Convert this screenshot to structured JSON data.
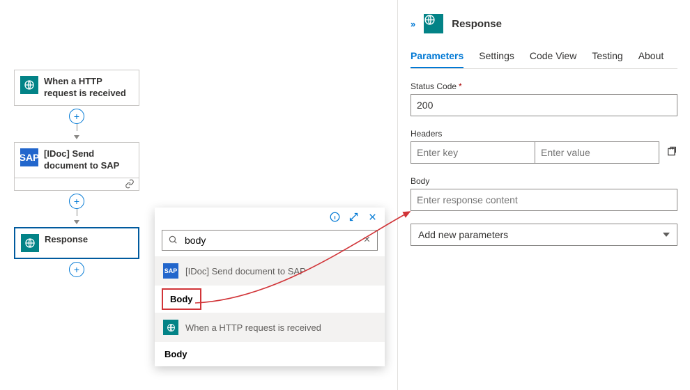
{
  "flow": {
    "nodes": [
      {
        "label": "When a HTTP request is received"
      },
      {
        "label": "[IDoc] Send document to SAP"
      },
      {
        "label": "Response"
      }
    ]
  },
  "picker": {
    "search_value": "body",
    "groups": [
      {
        "title": "[IDoc] Send document to SAP",
        "icon": "sap",
        "tokens": [
          "Body"
        ]
      },
      {
        "title": "When a HTTP request is received",
        "icon": "http",
        "tokens": [
          "Body"
        ]
      }
    ]
  },
  "panel": {
    "title": "Response",
    "tabs": [
      "Parameters",
      "Settings",
      "Code View",
      "Testing",
      "About"
    ],
    "active_tab": "Parameters",
    "status_code_label": "Status Code",
    "status_code_value": "200",
    "headers_label": "Headers",
    "headers_key_placeholder": "Enter key",
    "headers_value_placeholder": "Enter value",
    "body_label": "Body",
    "body_placeholder": "Enter response content",
    "add_params_label": "Add new parameters"
  }
}
